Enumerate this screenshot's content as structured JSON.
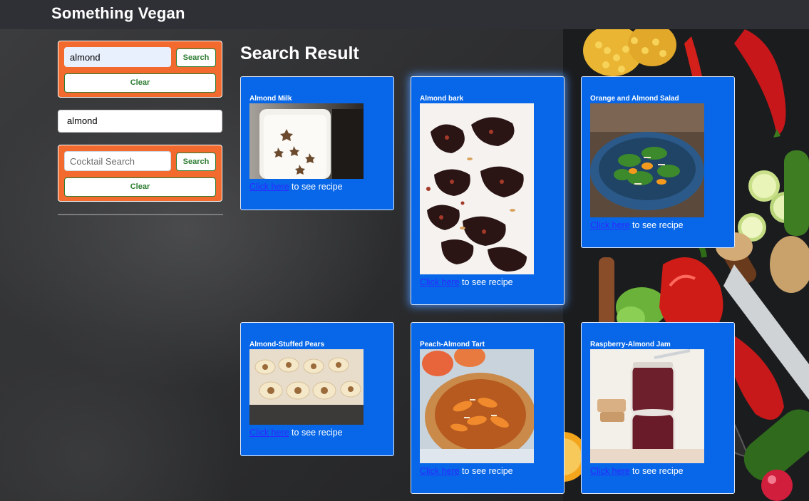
{
  "header": {
    "brand": "Something Vegan"
  },
  "recipe_search": {
    "value": "almond",
    "search_label": "Search",
    "clear_label": "Clear"
  },
  "history": [
    {
      "label": "almond"
    }
  ],
  "cocktail_search": {
    "value": "",
    "placeholder": "Cocktail Search",
    "search_label": "Search",
    "clear_label": "Clear"
  },
  "results": {
    "title": "Search Result",
    "link_text": "Click here",
    "link_suffix": " to see recipe",
    "cards": [
      {
        "title": "Almond Milk"
      },
      {
        "title": "Almond bark"
      },
      {
        "title": "Orange and Almond Salad"
      },
      {
        "title": "Almond-Stuffed Pears"
      },
      {
        "title": "Peach-Almond Tart"
      },
      {
        "title": "Raspberry-Almond Jam"
      }
    ]
  },
  "colors": {
    "header_bg": "#2e3035",
    "panel_orange": "#f26a2d",
    "button_green": "#2e7d32",
    "card_blue": "#0767e8",
    "link_blue": "#2b2bff"
  }
}
